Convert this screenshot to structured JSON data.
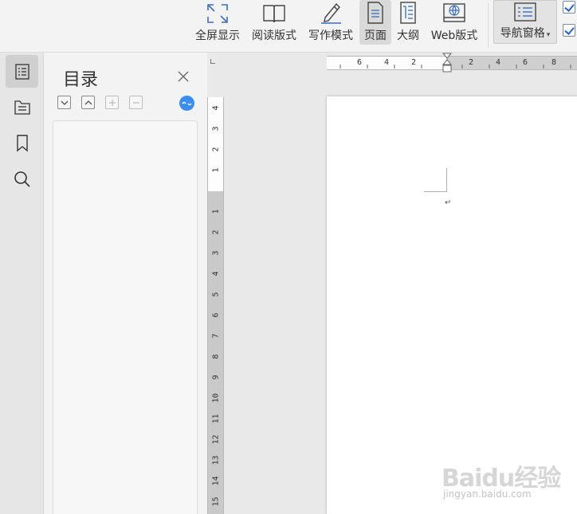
{
  "ribbon": {
    "fullscreen_label": "全屏显示",
    "reading_label": "阅读版式",
    "writing_label": "写作模式",
    "page_label": "页面",
    "outline_label": "大纲",
    "web_label": "Web版式",
    "navpane_label": "导航窗格"
  },
  "sidebar": {
    "items": [
      "toc",
      "toc-structure",
      "bookmark",
      "search"
    ]
  },
  "toc_panel": {
    "title": "目录"
  },
  "ruler": {
    "horizontal": [
      "6",
      "4",
      "2",
      "2",
      "4",
      "6",
      "8"
    ],
    "vertical_top": [
      "4",
      "3",
      "2",
      "1"
    ],
    "vertical_bottom": [
      "1",
      "2",
      "3",
      "4",
      "5",
      "6",
      "7",
      "8",
      "9",
      "10",
      "11",
      "12",
      "13",
      "14",
      "15"
    ]
  },
  "watermark": {
    "logo": "Baidu经验",
    "url": "jingyan.baidu.com"
  },
  "colors": {
    "accent": "#3b8ef0",
    "ribbon_bg": "#f3f3f3",
    "workspace_bg": "#e9e9e9"
  }
}
